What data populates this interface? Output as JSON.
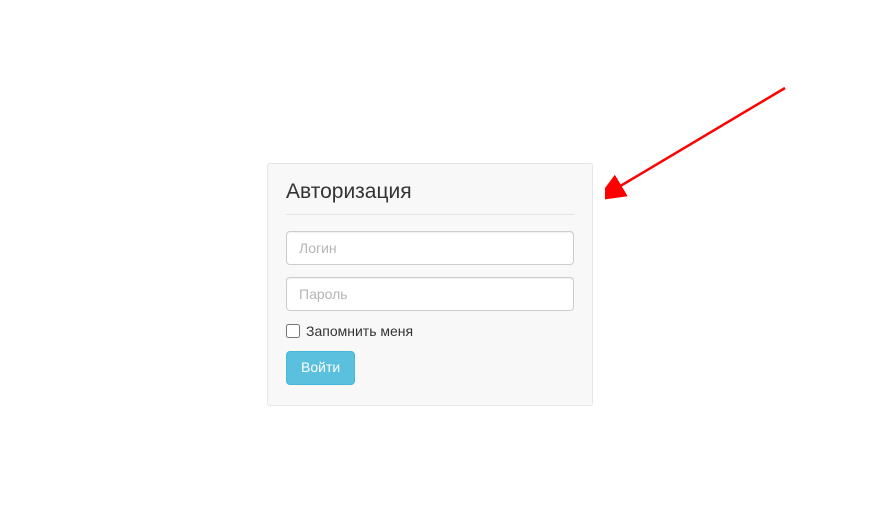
{
  "login": {
    "title": "Авторизация",
    "username_placeholder": "Логин",
    "password_placeholder": "Пароль",
    "remember_label": "Запомнить меня",
    "submit_label": "Войти"
  },
  "annotation": {
    "arrow_color": "#ff0000"
  }
}
